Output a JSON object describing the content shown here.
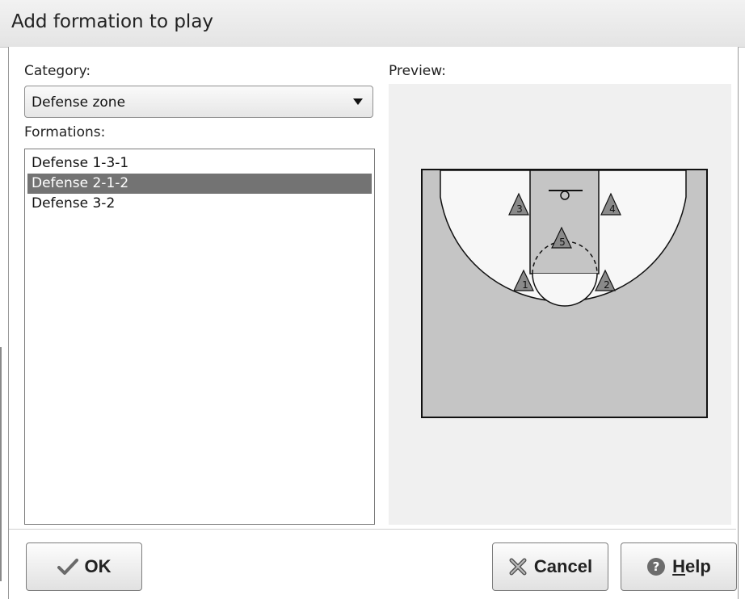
{
  "window": {
    "title": "Add formation to play"
  },
  "category": {
    "label": "Category:",
    "selected": "Defense zone"
  },
  "formations": {
    "label": "Formations:",
    "items": [
      "Defense 1-3-1",
      "Defense 2-1-2",
      "Defense 3-2"
    ],
    "selected_index": 1
  },
  "preview": {
    "label": "Preview:",
    "players": [
      "1",
      "2",
      "3",
      "4",
      "5"
    ]
  },
  "buttons": {
    "ok": "OK",
    "cancel": "Cancel",
    "help_underlined": "H",
    "help_rest": "elp"
  },
  "colors": {
    "court_floor": "#c5c5c5",
    "key_area": "#c5c5c5",
    "arc_area": "#f7f7f7",
    "player_marker": "#8a8a8a",
    "selected_row": "#737373"
  }
}
